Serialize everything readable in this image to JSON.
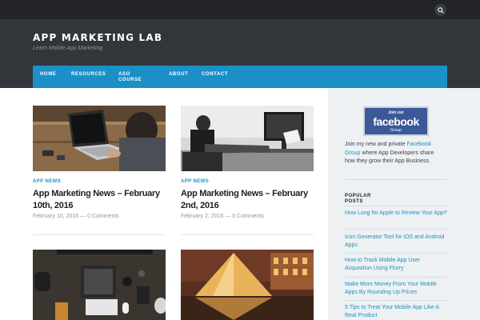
{
  "topbar": {
    "search_icon": "search-icon"
  },
  "site": {
    "title": "APP MARKETING LAB",
    "tagline": "Learn Mobile App Marketing"
  },
  "nav": {
    "items": [
      "HOME",
      "RESOURCES",
      "ASO",
      "COURSE",
      "ABOUT",
      "CONTACT"
    ]
  },
  "posts": [
    {
      "category": "APP NEWS",
      "title": "App Marketing News – February 10th, 2016",
      "date": "February 10, 2016",
      "comments": "0 Comments"
    },
    {
      "category": "APP NEWS",
      "title": "App Marketing News – February 2nd, 2016",
      "date": "February 2, 2016",
      "comments": "0 Comments"
    }
  ],
  "meta_separator": "—",
  "sidebar": {
    "facebook": {
      "join": "Join our",
      "word": "facebook",
      "group": "Group"
    },
    "join_before": "Join my new and private ",
    "join_link": "Facebook Group",
    "join_after": " where App Developers share how they grow their App Business.",
    "popular_title_1": "POPULAR",
    "popular_title_2": "POSTS",
    "popular_posts": [
      "How Long for Apple to Review Your App?",
      "Icon Generator Tool for iOS and Android Apps",
      "How to Track Mobile App User Acquisition Using Flurry",
      "Make More Money From Your Mobile Apps By Rounding Up Prices",
      "5 Tips to Treat Your Mobile App Like A Real Product"
    ]
  },
  "colors": {
    "accent": "#1a90c7",
    "header": "#32363b",
    "topbar": "#222427",
    "facebook": "#3b5998"
  }
}
